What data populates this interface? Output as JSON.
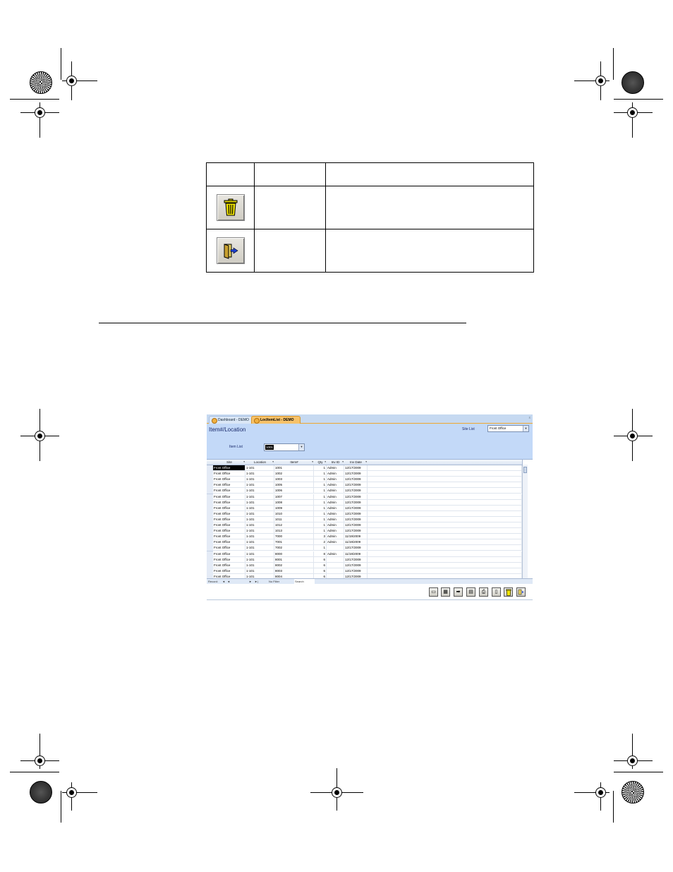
{
  "table": {
    "rows": [
      {
        "icon": "trash-icon",
        "name": "",
        "description": ""
      },
      {
        "icon": "exit-door-icon",
        "name": "",
        "description": ""
      }
    ]
  },
  "app": {
    "tabs": [
      {
        "label": "Dashboard - DEMO"
      },
      {
        "label": "LocItemList - DEMO"
      }
    ],
    "form_title": "Item#/Location",
    "site_list_label": "Site List",
    "site_list_value": "Front Office",
    "item_list_label": "Item List",
    "item_list_value": "1001",
    "columns": [
      "Site",
      "Location",
      "Item#",
      "Qty",
      "Inv ID",
      "Inv Date"
    ],
    "rows": [
      [
        "Front Office",
        "1-101",
        "1001",
        "1",
        "Admin",
        "12/17/2009"
      ],
      [
        "Front Office",
        "1-101",
        "1002",
        "1",
        "Admin",
        "12/17/2009"
      ],
      [
        "Front Office",
        "1-101",
        "1003",
        "1",
        "Admin",
        "12/17/2009"
      ],
      [
        "Front Office",
        "1-101",
        "1005",
        "1",
        "Admin",
        "12/17/2009"
      ],
      [
        "Front Office",
        "1-101",
        "1006",
        "1",
        "Admin",
        "12/17/2009"
      ],
      [
        "Front Office",
        "1-101",
        "1007",
        "1",
        "Admin",
        "12/17/2009"
      ],
      [
        "Front Office",
        "1-101",
        "1008",
        "1",
        "Admin",
        "12/17/2009"
      ],
      [
        "Front Office",
        "1-101",
        "1009",
        "1",
        "Admin",
        "12/17/2009"
      ],
      [
        "Front Office",
        "1-101",
        "1010",
        "1",
        "Admin",
        "12/17/2009"
      ],
      [
        "Front Office",
        "1-101",
        "1011",
        "1",
        "Admin",
        "12/17/2009"
      ],
      [
        "Front Office",
        "1-101",
        "1012",
        "1",
        "Admin",
        "12/17/2009"
      ],
      [
        "Front Office",
        "1-101",
        "1013",
        "1",
        "Admin",
        "12/17/2009"
      ],
      [
        "Front Office",
        "1-101",
        "7000",
        "3",
        "Admin",
        "11/19/2009"
      ],
      [
        "Front Office",
        "1-101",
        "7001",
        "2",
        "Admin",
        "11/19/2009"
      ],
      [
        "Front Office",
        "1-101",
        "7002",
        "1",
        "",
        "12/17/2009"
      ],
      [
        "Front Office",
        "1-101",
        "8000",
        "8",
        "Admin",
        "11/19/2009"
      ],
      [
        "Front Office",
        "1-101",
        "8001",
        "6",
        "",
        "12/17/2009"
      ],
      [
        "Front Office",
        "1-101",
        "8002",
        "6",
        "",
        "12/17/2009"
      ],
      [
        "Front Office",
        "1-101",
        "8003",
        "6",
        "",
        "12/17/2009"
      ],
      [
        "Front Office",
        "1-101",
        "8004",
        "6",
        "",
        "12/17/2009"
      ]
    ],
    "nav": {
      "record_label": "Record:",
      "first": "◄",
      "prev": "◄",
      "next": "►",
      "last": "►|",
      "filter_label": "No Filter",
      "search_label": "Search"
    },
    "toolbar_icons": [
      "new-record-icon",
      "list-icon",
      "arrow-right-icon",
      "report-icon",
      "print-icon",
      "preview-icon",
      "trash-icon",
      "exit-door-icon"
    ]
  }
}
